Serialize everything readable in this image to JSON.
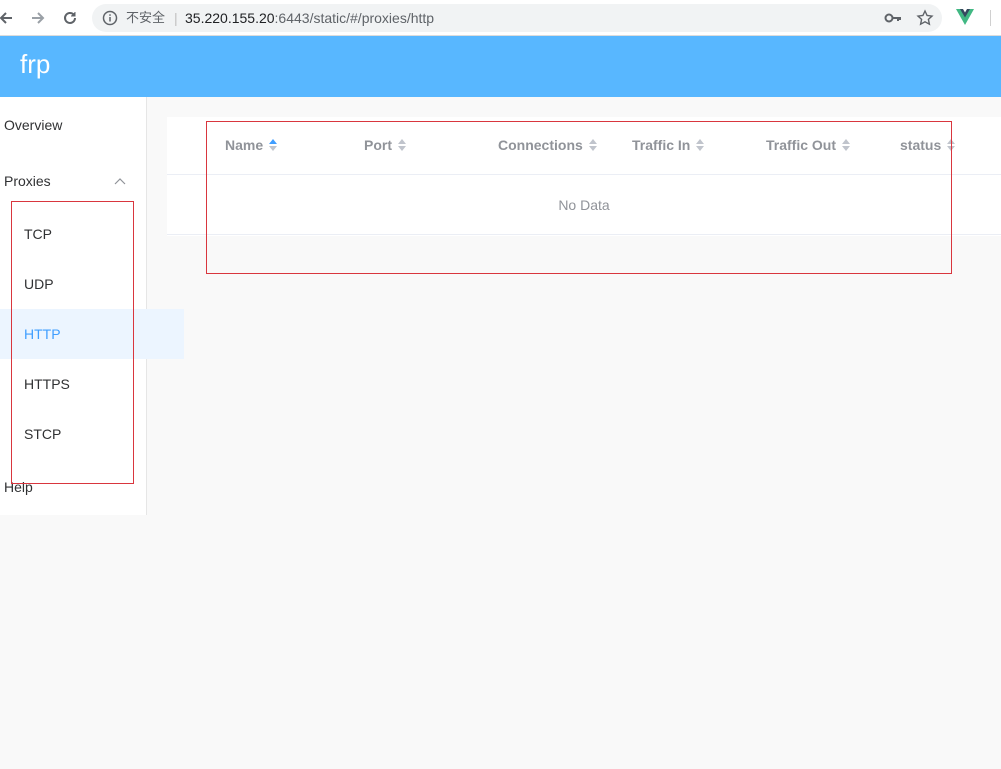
{
  "browser": {
    "security_label": "不安全",
    "separator": "|",
    "url_host": "35.220.155.20",
    "url_rest": ":6443/static/#/proxies/http"
  },
  "app": {
    "brand": "frp"
  },
  "sidebar": {
    "items": [
      {
        "label": "Overview"
      },
      {
        "label": "Proxies"
      },
      {
        "label": "Help"
      }
    ],
    "proxies_submenu": [
      {
        "label": "TCP"
      },
      {
        "label": "UDP"
      },
      {
        "label": "HTTP",
        "active": true
      },
      {
        "label": "HTTPS"
      },
      {
        "label": "STCP"
      }
    ]
  },
  "table": {
    "columns": [
      {
        "label": "Name",
        "sorted": "ascending"
      },
      {
        "label": "Port"
      },
      {
        "label": "Connections"
      },
      {
        "label": "Traffic In"
      },
      {
        "label": "Traffic Out"
      },
      {
        "label": "status"
      }
    ],
    "empty_text": "No Data"
  },
  "colors": {
    "header": "#58b7ff",
    "active": "#409eff",
    "active_bg": "#ecf5ff",
    "annotation": "#d9363e"
  }
}
